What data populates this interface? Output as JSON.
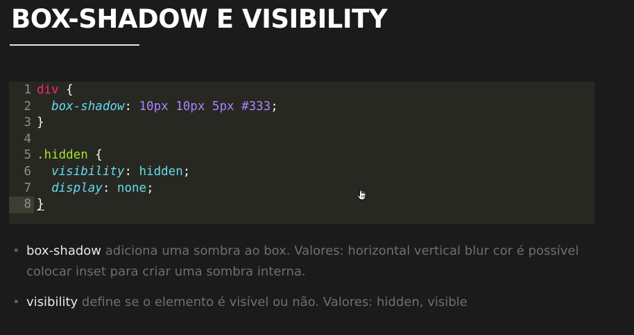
{
  "title": "BOX-SHADOW E VISIBILITY",
  "code": {
    "active_line": 8,
    "lines": [
      {
        "num": "1",
        "tokens": [
          {
            "t": "div",
            "c": "tag"
          },
          {
            "t": " {",
            "c": "plain"
          }
        ]
      },
      {
        "num": "2",
        "tokens": [
          {
            "t": "  ",
            "c": "plain"
          },
          {
            "t": "box-shadow",
            "c": "prop"
          },
          {
            "t": ": ",
            "c": "plain"
          },
          {
            "t": "10px",
            "c": "num"
          },
          {
            "t": " ",
            "c": "plain"
          },
          {
            "t": "10px",
            "c": "num"
          },
          {
            "t": " ",
            "c": "plain"
          },
          {
            "t": "5px",
            "c": "num"
          },
          {
            "t": " ",
            "c": "plain"
          },
          {
            "t": "#333",
            "c": "num"
          },
          {
            "t": ";",
            "c": "plain"
          }
        ]
      },
      {
        "num": "3",
        "tokens": [
          {
            "t": "}",
            "c": "plain"
          }
        ]
      },
      {
        "num": "4",
        "tokens": []
      },
      {
        "num": "5",
        "tokens": [
          {
            "t": ".hidden",
            "c": "class"
          },
          {
            "t": " {",
            "c": "plain"
          }
        ]
      },
      {
        "num": "6",
        "tokens": [
          {
            "t": "  ",
            "c": "plain"
          },
          {
            "t": "visibility",
            "c": "prop"
          },
          {
            "t": ": ",
            "c": "plain"
          },
          {
            "t": "hidden",
            "c": "value"
          },
          {
            "t": ";",
            "c": "plain"
          }
        ]
      },
      {
        "num": "7",
        "tokens": [
          {
            "t": "  ",
            "c": "plain"
          },
          {
            "t": "display",
            "c": "prop"
          },
          {
            "t": ": ",
            "c": "plain"
          },
          {
            "t": "none",
            "c": "value"
          },
          {
            "t": ";",
            "c": "plain"
          }
        ]
      },
      {
        "num": "8",
        "tokens": [
          {
            "t": "}",
            "c": "brace-ul"
          }
        ]
      }
    ]
  },
  "bullets": [
    {
      "term": "box-shadow",
      "text": " adiciona uma sombra ao box. Valores: horizontal vertical blur cor é possível colocar inset para criar uma sombra interna."
    },
    {
      "term": "visibility",
      "text": " define se o elemento é visível ou não. Valores: hidden, visible"
    }
  ],
  "bullet_symbol": "•",
  "icons": {
    "cursor": "hand-pointer-icon"
  },
  "colors": {
    "background": "#1b1b1b",
    "code_background": "#272822",
    "tag": "#f92672",
    "class": "#a6e22e",
    "property": "#66d9ef",
    "number": "#ae81ff"
  }
}
